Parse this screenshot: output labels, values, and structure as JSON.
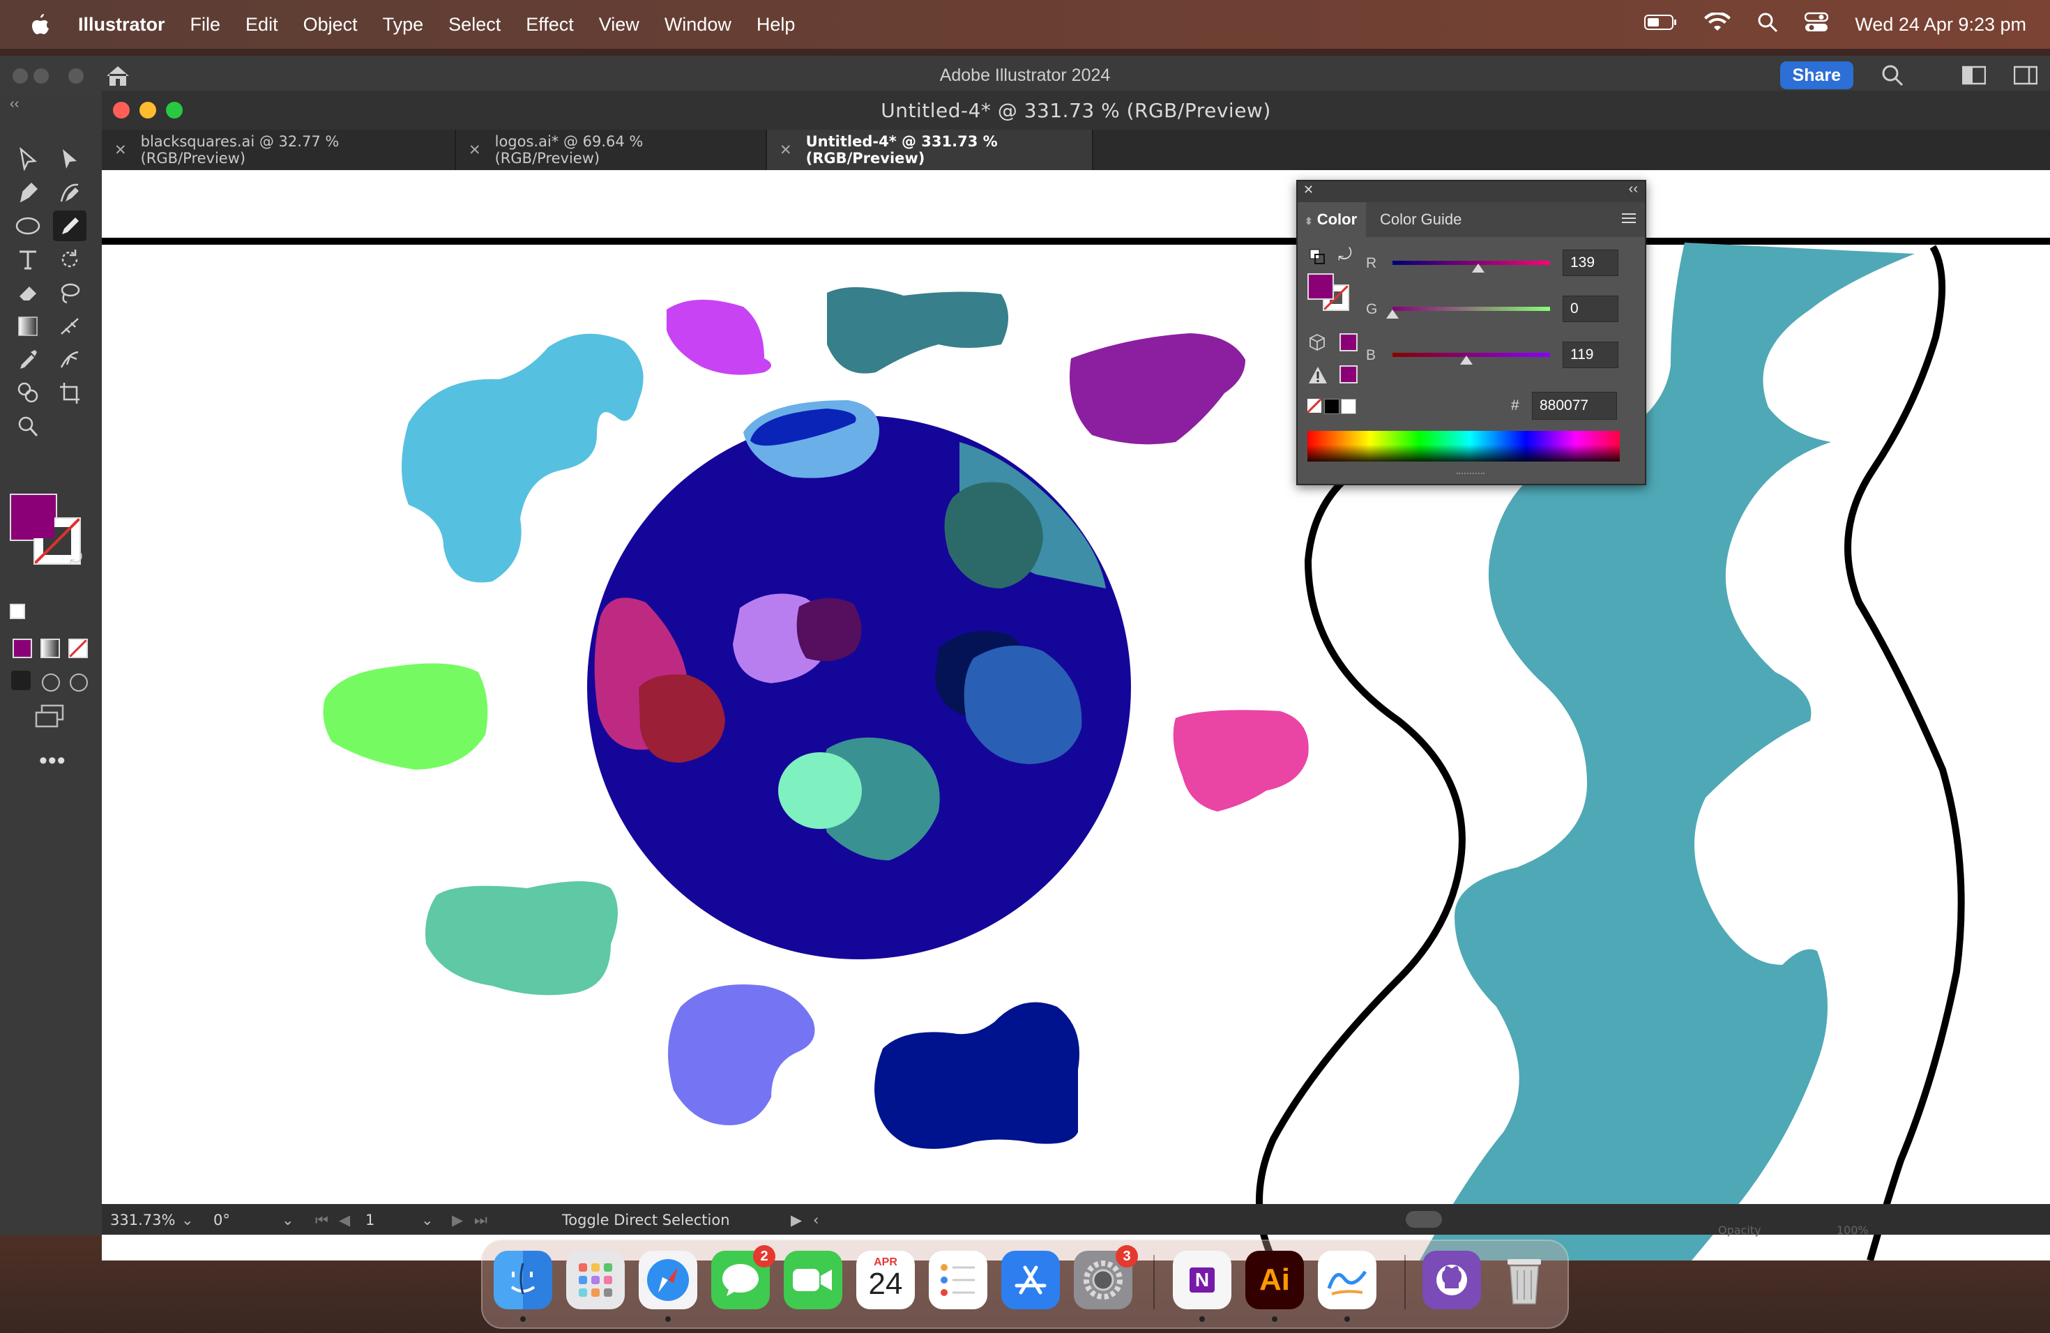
{
  "menubar": {
    "app_name": "Illustrator",
    "menus": [
      "File",
      "Edit",
      "Object",
      "Type",
      "Select",
      "Effect",
      "View",
      "Window",
      "Help"
    ],
    "clock": "Wed 24 Apr  9:23 pm"
  },
  "app": {
    "title": "Adobe Illustrator 2024",
    "share_label": "Share",
    "doc_title": "Untitled-4* @ 331.73 % (RGB/Preview)"
  },
  "tabs": [
    {
      "label": "blacksquares.ai @ 32.77 % (RGB/Preview)"
    },
    {
      "label": "logos.ai* @ 69.64 % (RGB/Preview)"
    },
    {
      "label": "Untitled-4* @ 331.73 % (RGB/Preview)"
    }
  ],
  "color_panel": {
    "tab_color": "Color",
    "tab_guide": "Color Guide",
    "r_label": "R",
    "g_label": "G",
    "b_label": "B",
    "r": "139",
    "g": "0",
    "b": "119",
    "r_fraction": 0.545,
    "g_fraction": 0.0,
    "b_fraction": 0.467,
    "hex_label": "#",
    "hex": "880077",
    "fill_color": "#8b0077"
  },
  "statusbar": {
    "zoom": "331.73%",
    "rotation": "0°",
    "artboard": "1",
    "tool_hint": "Toggle Direct Selection",
    "opacity_label": "Opacity",
    "opacity_value": "100%"
  },
  "dock": {
    "calendar_month": "APR",
    "calendar_day": "24",
    "messages_badge": "2",
    "settings_badge": "3",
    "illustrator_label": "Ai",
    "onenote_label": "N"
  }
}
